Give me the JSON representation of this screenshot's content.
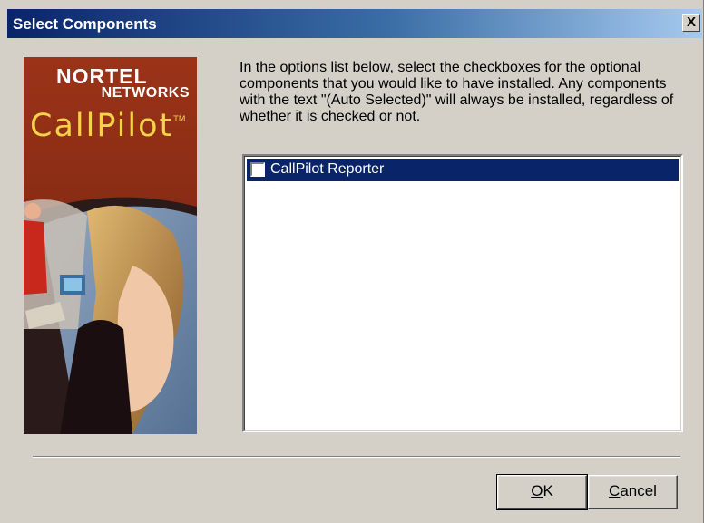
{
  "window": {
    "title": "Select Components",
    "close_glyph": "X"
  },
  "banner": {
    "brand_name": "NORTEL",
    "brand_sub": "NETWORKS",
    "product": "CallPilot",
    "trademark": "TM"
  },
  "instructions": "In the options list below, select the checkboxes for the optional components that you would like to have installed. Any components with the text \"(Auto Selected)\" will always be installed, regardless of whether it is checked or not.",
  "components": [
    {
      "label": "CallPilot Reporter",
      "checked": false,
      "selected": true
    }
  ],
  "buttons": {
    "ok_mnemonic": "O",
    "ok_rest": "K",
    "cancel_mnemonic": "C",
    "cancel_rest": "ancel"
  },
  "colors": {
    "titlebar_start": "#0a246a",
    "titlebar_end": "#a6caf0",
    "selection": "#0a246a",
    "dialog_bg": "#d4d0c8",
    "product_name": "#f4d24a"
  }
}
